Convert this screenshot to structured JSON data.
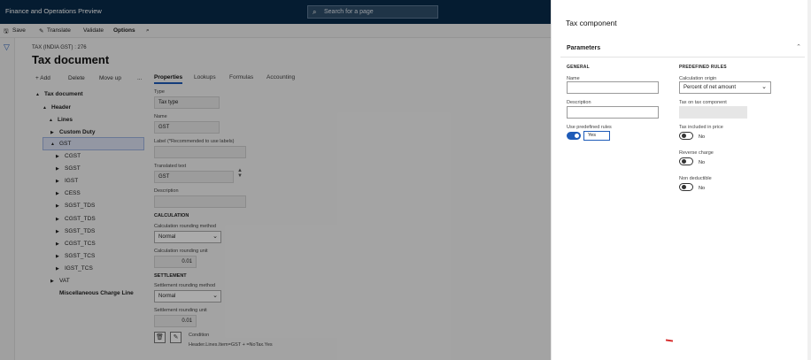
{
  "app": {
    "title": "Finance and Operations Preview",
    "search_placeholder": "Search for a page"
  },
  "actionbar": {
    "save": "Save",
    "translate": "Translate",
    "validate": "Validate",
    "options": "Options"
  },
  "page": {
    "breadcrumb": "TAX (INDIA GST) : 276",
    "title": "Tax document"
  },
  "tree_toolbar": {
    "add": "+ Add",
    "delete": "Delete",
    "move_up": "Move up",
    "more": "..."
  },
  "tree": [
    {
      "label": "Tax document"
    },
    {
      "label": "Header"
    },
    {
      "label": "Lines"
    },
    {
      "label": "Custom Duty"
    },
    {
      "label": "GST"
    },
    {
      "label": "CGST"
    },
    {
      "label": "SGST"
    },
    {
      "label": "IGST"
    },
    {
      "label": "CESS"
    },
    {
      "label": "SGST_TDS"
    },
    {
      "label": "CGST_TDS"
    },
    {
      "label": "SGST_TDS"
    },
    {
      "label": "CGST_TCS"
    },
    {
      "label": "SGST_TCS"
    },
    {
      "label": "IGST_TCS"
    },
    {
      "label": "VAT"
    },
    {
      "label": "Miscellaneous Charge Line"
    }
  ],
  "tabs": [
    "Properties",
    "Lookups",
    "Formulas",
    "Accounting"
  ],
  "properties": {
    "type_label": "Type",
    "type_value": "Tax type",
    "name_label": "Name",
    "name_value": "GST",
    "label_label": "Label (*Recommended to use labels)",
    "translated_label": "Translated text",
    "translated_value": "GST",
    "description_label": "Description",
    "calculation_heading": "CALCULATION",
    "calc_rounding_method_label": "Calculation rounding method",
    "calc_rounding_method_value": "Normal",
    "calc_rounding_unit_label": "Calculation rounding unit",
    "calc_rounding_unit_value": "0.01",
    "settlement_heading": "SETTLEMENT",
    "settle_rounding_method_label": "Settlement rounding method",
    "settle_rounding_method_value": "Normal",
    "settle_rounding_unit_label": "Settlement rounding unit",
    "settle_rounding_unit_value": "0.01",
    "condition_label": "Condition",
    "condition_value": "Header.Lines.Item=GST + =NoTax.Yes"
  },
  "panel": {
    "title": "Tax component",
    "section": "Parameters",
    "general_heading": "GENERAL",
    "name_label": "Name",
    "description_label": "Description",
    "use_predefined_label": "Use predefined rules",
    "use_predefined_value": "Yes",
    "predefined_heading": "PREDEFINED RULES",
    "calc_origin_label": "Calculation origin",
    "calc_origin_value": "Percent of net amount",
    "tax_on_tax_label": "Tax on tax component",
    "tax_included_label": "Tax included in price",
    "tax_included_value": "No",
    "reverse_charge_label": "Reverse charge",
    "reverse_charge_value": "No",
    "non_deductible_label": "Non deductible",
    "non_deductible_value": "No"
  }
}
